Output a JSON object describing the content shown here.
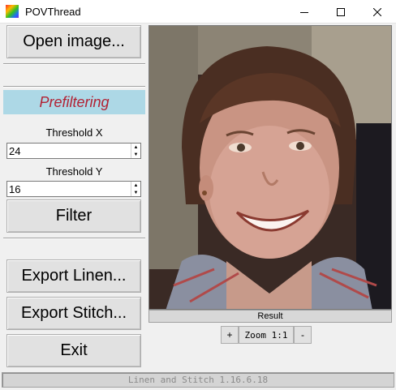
{
  "window": {
    "title": "POVThread",
    "minimize_icon": "minimize-icon",
    "maximize_icon": "maximize-icon",
    "close_icon": "close-icon"
  },
  "sidebar": {
    "open_label": "Open image...",
    "section_title": "Prefiltering",
    "threshold_x_label": "Threshold X",
    "threshold_x_value": "24",
    "threshold_y_label": "Threshold Y",
    "threshold_y_value": "16",
    "filter_label": "Filter",
    "export_linen_label": "Export Linen...",
    "export_stitch_label": "Export Stitch...",
    "exit_label": "Exit"
  },
  "viewer": {
    "caption": "Result",
    "zoom_in": "+",
    "zoom_label": "Zoom 1:1",
    "zoom_out": "-"
  },
  "status": {
    "text": "Linen and Stitch 1.16.6.18"
  },
  "colors": {
    "section_bg": "#add8e6",
    "section_text": "#b22234"
  }
}
